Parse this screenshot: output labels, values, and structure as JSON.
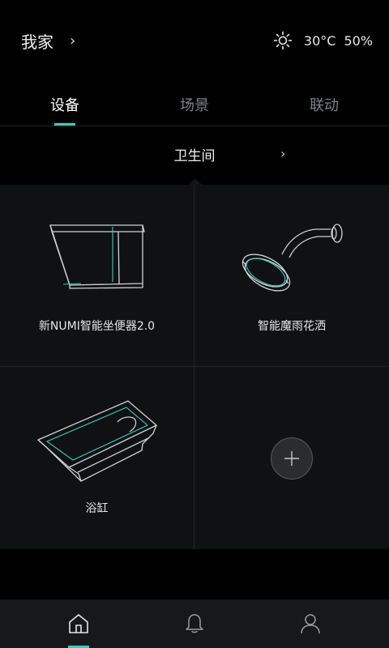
{
  "header": {
    "home_title": "我家",
    "home_chevron": "›",
    "weather_icon": "sun-icon",
    "temperature": "30°C",
    "humidity": "50%"
  },
  "tabs": [
    {
      "label": "设备",
      "active": true
    },
    {
      "label": "场景",
      "active": false
    },
    {
      "label": "联动",
      "active": false
    }
  ],
  "room": {
    "name": "卫生间",
    "chevron": "›"
  },
  "devices": [
    {
      "label": "新NUMI智能坐便器2.0",
      "icon": "toilet-icon"
    },
    {
      "label": "智能魔雨花洒",
      "icon": "shower-head-icon"
    },
    {
      "label": "浴缸",
      "icon": "bathtub-icon"
    }
  ],
  "add_device": {
    "icon": "plus-icon"
  },
  "bottom_nav": [
    {
      "icon": "home-icon",
      "active": true
    },
    {
      "icon": "bell-icon",
      "active": false
    },
    {
      "icon": "user-icon",
      "active": false
    }
  ],
  "colors": {
    "accent": "#2ed1c8",
    "background": "#000000",
    "grid_bg": "#0f1113",
    "bottom_bar": "#16181a"
  }
}
